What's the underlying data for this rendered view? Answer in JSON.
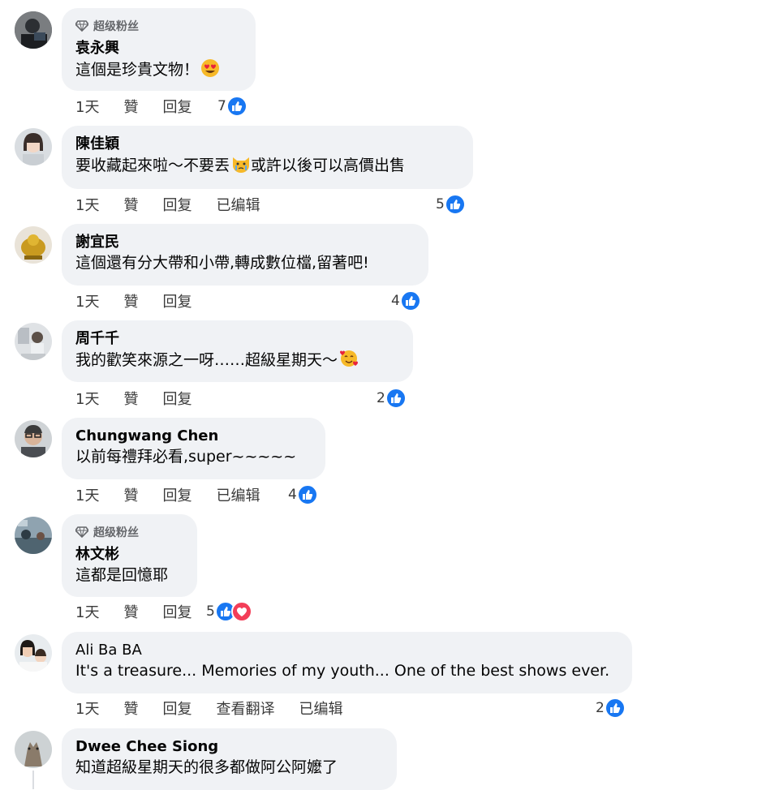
{
  "comments": [
    {
      "name": "袁永興",
      "badge": "超级粉丝",
      "text": "這個是珍貴文物！",
      "emoji": "heart-eyes",
      "actions": [
        "1天",
        "贊",
        "回复"
      ],
      "reactions": "7"
    },
    {
      "name": "陳佳穎",
      "text1": "要收藏起來啦～不要丟",
      "text2": "或許以後可以高價出售",
      "emoji": "crying-cat",
      "actions": [
        "1天",
        "贊",
        "回复",
        "已编辑"
      ],
      "reactions": "5"
    },
    {
      "name": "謝宜民",
      "text": "這個還有分大帶和小帶,轉成數位檔,留著吧!",
      "actions": [
        "1天",
        "贊",
        "回复"
      ],
      "reactions": "4"
    },
    {
      "name": "周千千",
      "text": "我的歡笑來源之一呀……超級星期天～",
      "emoji": "smiling-face-with-hearts",
      "actions": [
        "1天",
        "贊",
        "回复"
      ],
      "reactions": "2"
    },
    {
      "name": "Chungwang Chen",
      "text": "以前每禮拜必看,super~~~~~",
      "actions": [
        "1天",
        "贊",
        "回复",
        "已编辑"
      ],
      "reactions": "4"
    },
    {
      "name": "林文彬",
      "badge": "超级粉丝",
      "text": "這都是回憶耶",
      "actions": [
        "1天",
        "贊",
        "回复"
      ],
      "reactions": "5"
    },
    {
      "name": "Ali Ba BA",
      "text": "It's a treasure... Memories of my youth... One of the best shows ever.",
      "actions": [
        "1天",
        "贊",
        "回复",
        "查看翻译",
        "已编辑"
      ],
      "reactions": "2"
    },
    {
      "name": "Dwee Chee Siong",
      "text": "知道超級星期天的很多都做阿公阿嬤了"
    }
  ],
  "colors": {
    "like": "#1877f2",
    "love": "#f33e58",
    "bubble": "#f0f2f5"
  }
}
